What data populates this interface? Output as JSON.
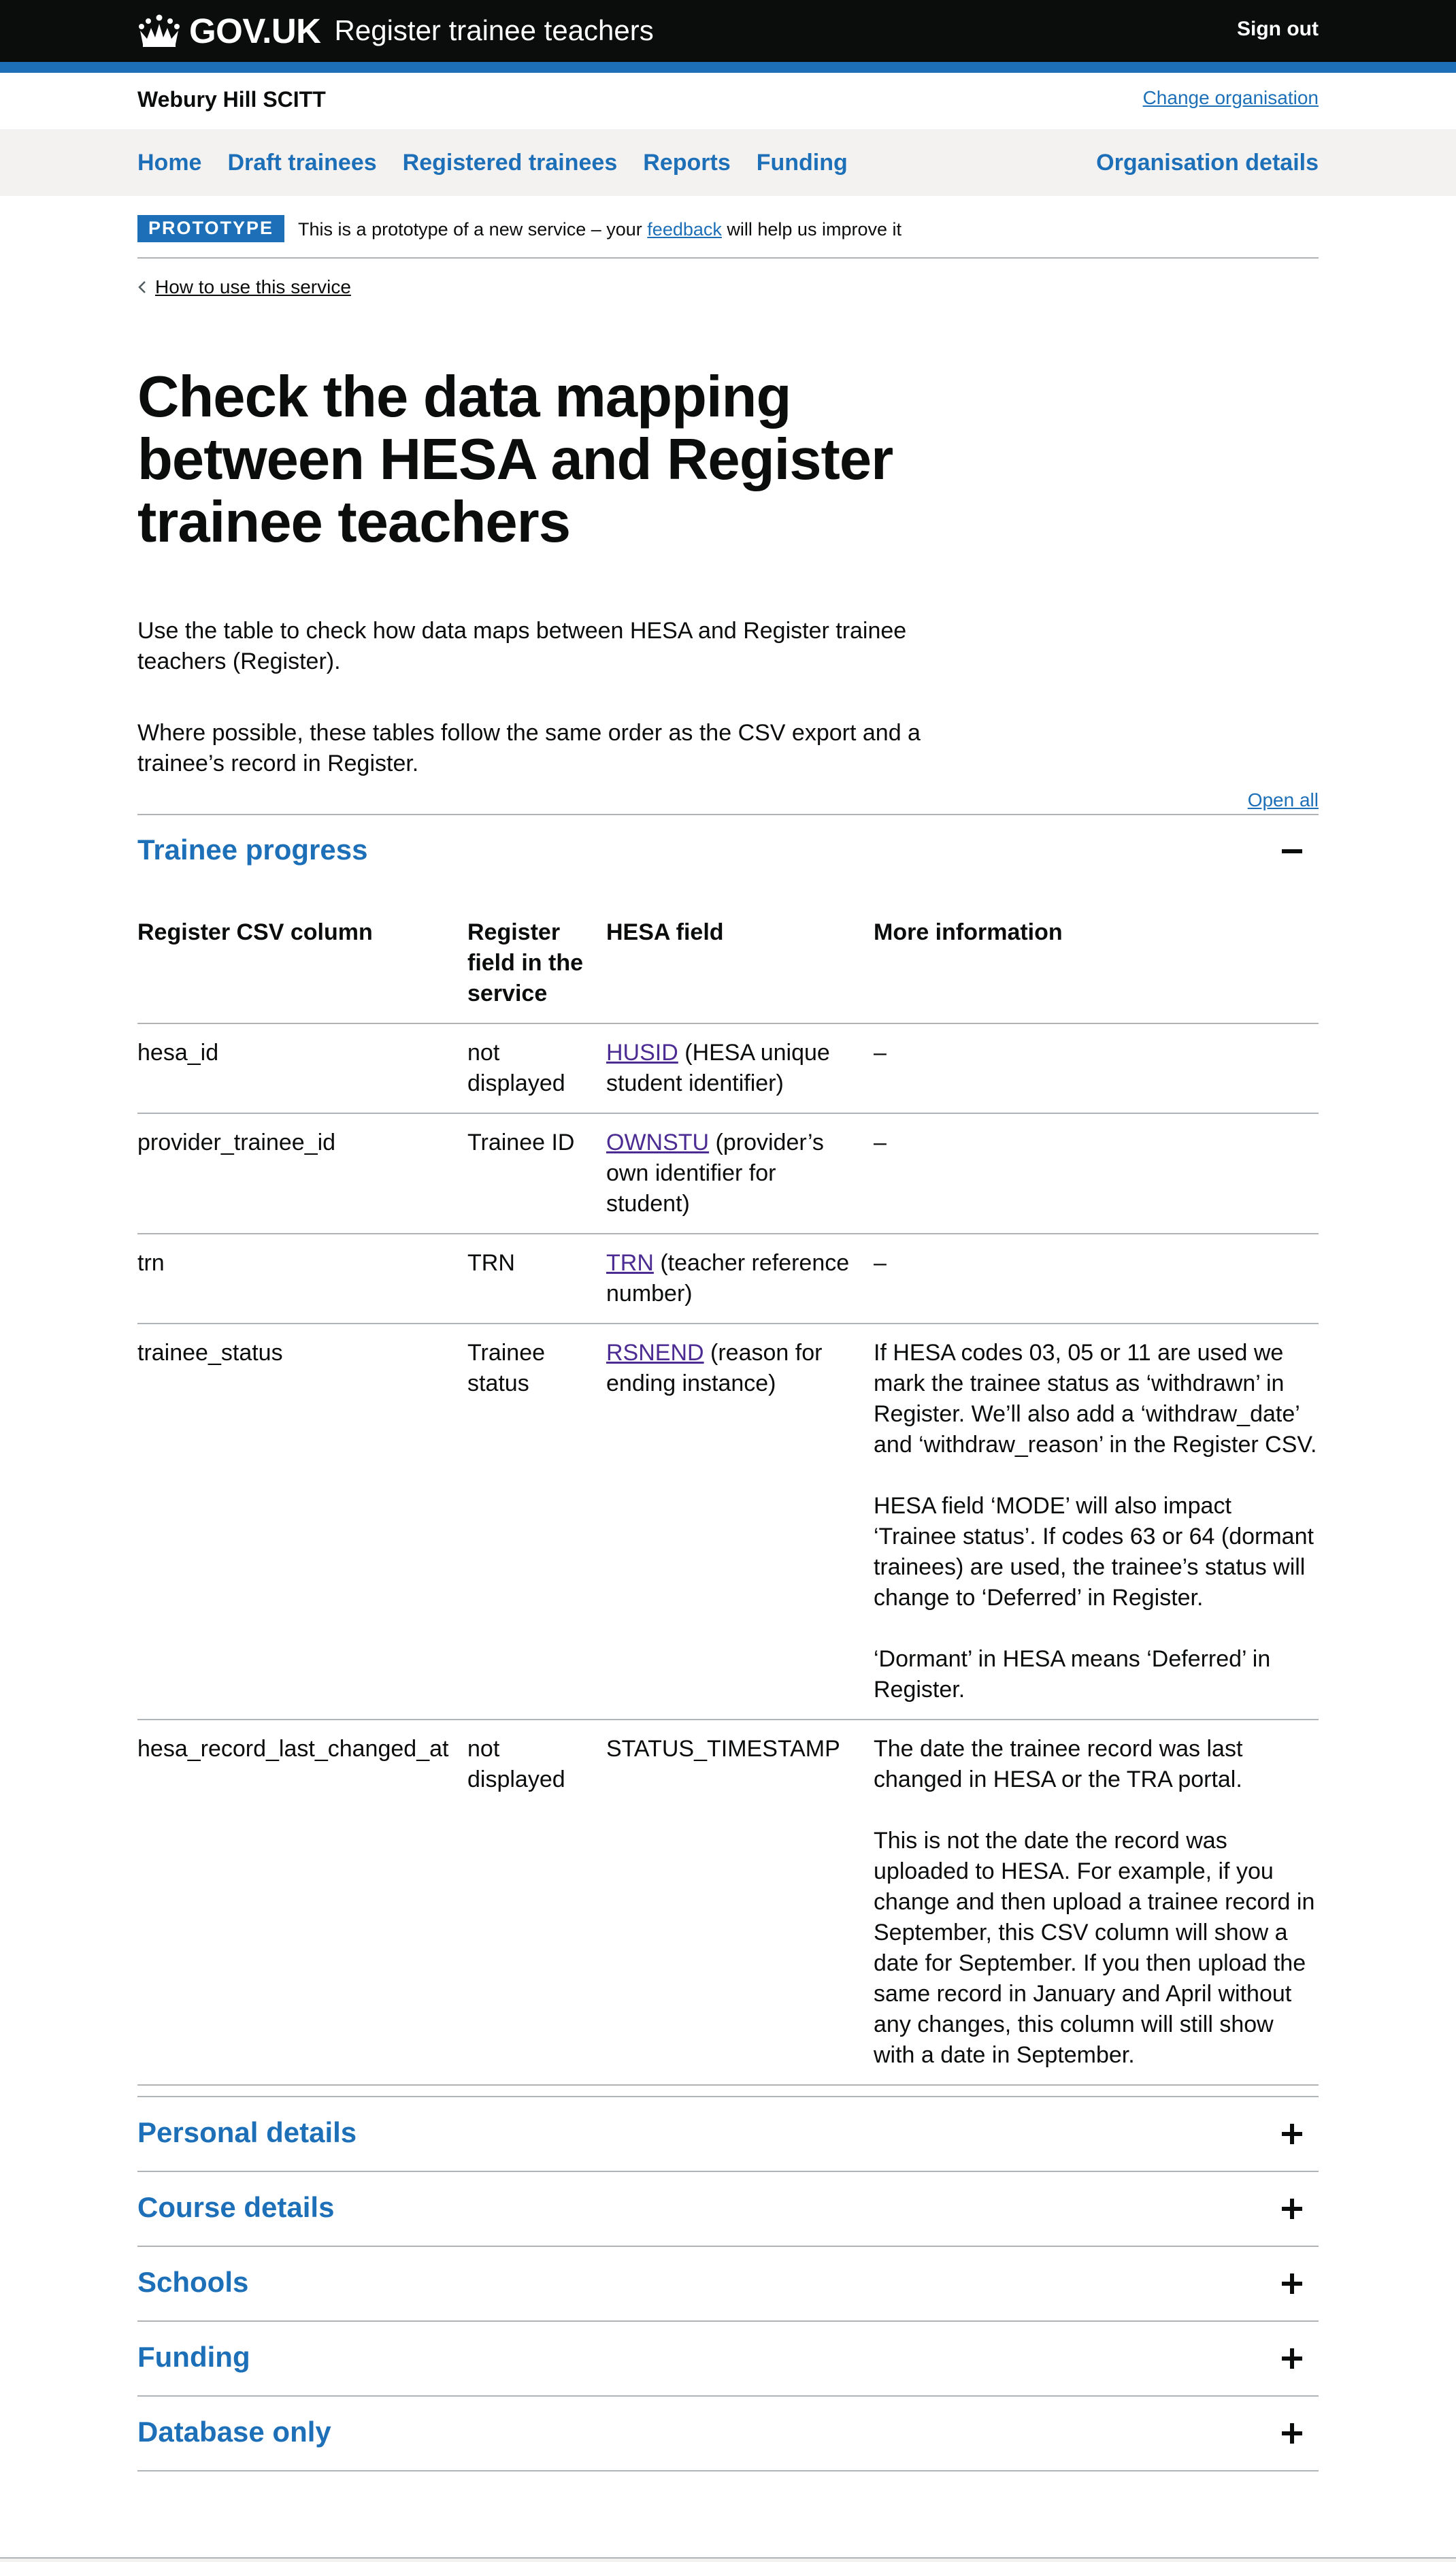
{
  "header": {
    "logo_text": "GOV.UK",
    "service_name": "Register trainee teachers",
    "sign_out": "Sign out"
  },
  "org": {
    "name": "Webury Hill SCITT",
    "change_link": "Change organisation"
  },
  "nav": {
    "items": [
      "Home",
      "Draft trainees",
      "Registered trainees",
      "Reports",
      "Funding"
    ],
    "right": "Organisation details"
  },
  "phase_banner": {
    "tag": "PROTOTYPE",
    "text_before": "This is a prototype of a new service – your ",
    "link": "feedback",
    "text_after": " will help us improve it"
  },
  "back_link": "How to use this service",
  "page": {
    "title": "Check the data mapping between HESA and Register trainee teachers",
    "intro_1": "Use the table to check how data maps between HESA and Register trainee teachers (Register).",
    "intro_2": "Where possible, these tables follow the same order as the CSV export and a trainee’s record in Register.",
    "open_all": "Open all"
  },
  "accordion": {
    "open_section": "Trainee progress",
    "closed_sections": [
      "Personal details",
      "Course details",
      "Schools",
      "Funding",
      "Database only"
    ]
  },
  "table": {
    "headers": [
      "Register CSV column",
      "Register field in the service",
      "HESA field",
      "More information"
    ],
    "rows": [
      {
        "csv": "hesa_id",
        "field": "not displayed",
        "hesa_code": "HUSID",
        "hesa_desc": " (HESA unique student identifier)",
        "info": [
          "–"
        ]
      },
      {
        "csv": "provider_trainee_id",
        "field": "Trainee ID",
        "hesa_code": "OWNSTU",
        "hesa_desc": " (provider’s own identifier for student)",
        "info": [
          "–"
        ]
      },
      {
        "csv": "trn",
        "field": "TRN",
        "hesa_code": "TRN",
        "hesa_desc": " (teacher reference number)",
        "info": [
          "–"
        ]
      },
      {
        "csv": "trainee_status",
        "field": "Trainee status",
        "hesa_code": "RSNEND",
        "hesa_desc": " (reason for ending instance)",
        "info": [
          "If HESA codes 03, 05 or 11 are used we mark the trainee status as ‘withdrawn’ in Register. We’ll also add a ‘withdraw_date’ and ‘withdraw_reason’ in the Register CSV.",
          "HESA field ‘MODE’ will also impact ‘Trainee status’. If codes 63 or 64 (dormant trainees) are used, the trainee’s status will change to ‘Deferred’ in Register.",
          "‘Dormant’ in HESA means ‘Deferred’ in Register."
        ]
      },
      {
        "csv": "hesa_record_last_changed_at",
        "field": "not displayed",
        "hesa_plain": "STATUS_TIMESTAMP",
        "info": [
          "The date the trainee record was last changed in HESA or the TRA portal.",
          "This is not the date the record was uploaded to HESA. For example, if you change and then upload a trainee record in September, this CSV column will show a date for September. If you then upload the same record in January and April without any changes, this column will still show with a date in September."
        ]
      }
    ]
  }
}
